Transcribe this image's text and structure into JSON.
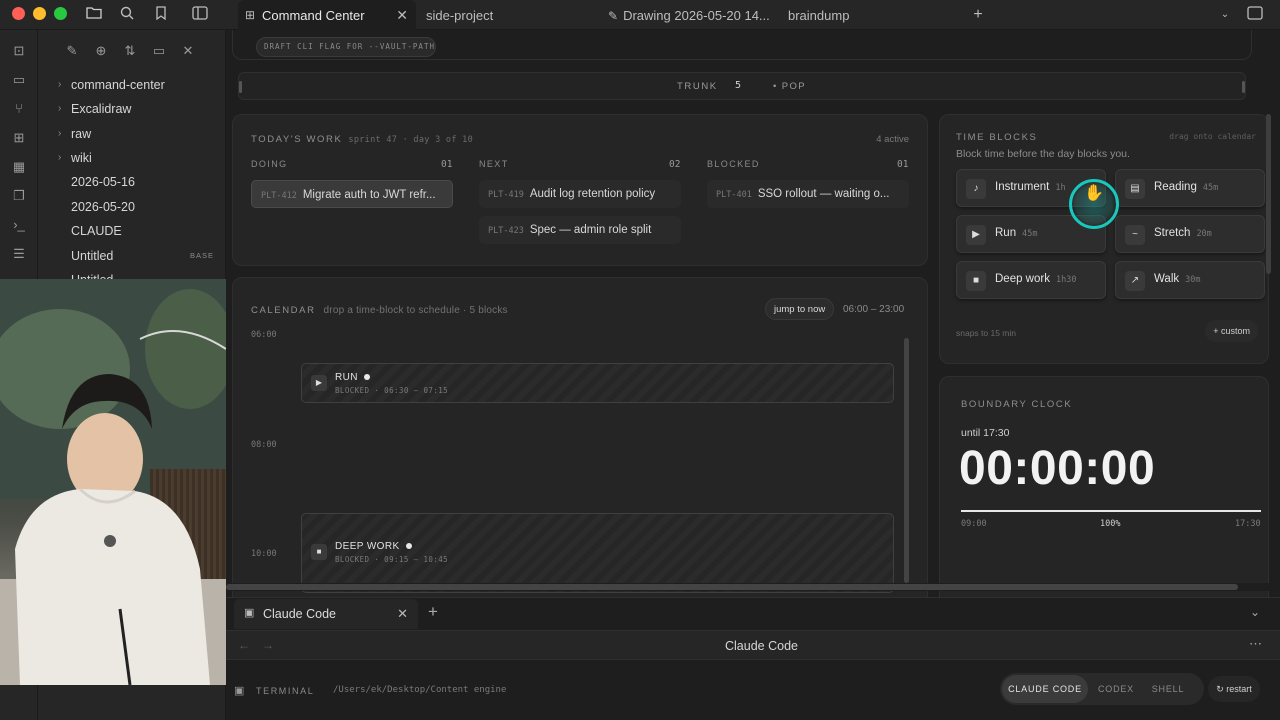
{
  "tabs": [
    {
      "label": "Command Center",
      "icon": "grid-icon",
      "active": true
    },
    {
      "label": "side-project"
    },
    {
      "label": "Drawing 2026-05-20 14...",
      "icon": "excalidraw-icon"
    },
    {
      "label": "braindump"
    }
  ],
  "explorer": {
    "items": [
      {
        "label": "command-center",
        "folder": true
      },
      {
        "label": "Excalidraw",
        "folder": true
      },
      {
        "label": "raw",
        "folder": true
      },
      {
        "label": "wiki",
        "folder": true
      },
      {
        "label": "2026-05-16",
        "folder": false
      },
      {
        "label": "2026-05-20",
        "folder": false
      },
      {
        "label": "CLAUDE",
        "folder": false
      },
      {
        "label": "Untitled",
        "folder": false,
        "badge": "BASE"
      },
      {
        "label": "Untitled",
        "folder": false
      }
    ]
  },
  "top_strip": {
    "hint": "DRAFT CLI FLAG FOR --VAULT-PATH",
    "trunk_label": "TRUNK",
    "trunk_count": "5",
    "pop_label": "• POP"
  },
  "todays_work": {
    "title": "TODAY'S WORK",
    "subtitle": "sprint 47 · day 3 of 10",
    "active_count": "4 active",
    "columns": [
      {
        "name": "DOING",
        "count": "01",
        "tickets": [
          {
            "id": "PLT-412",
            "title": "Migrate auth to JWT refr...",
            "active": true
          }
        ]
      },
      {
        "name": "NEXT",
        "count": "02",
        "tickets": [
          {
            "id": "PLT-419",
            "title": "Audit log retention policy"
          },
          {
            "id": "PLT-423",
            "title": "Spec — admin role split"
          }
        ]
      },
      {
        "name": "BLOCKED",
        "count": "01",
        "tickets": [
          {
            "id": "PLT-401",
            "title": "SSO rollout — waiting o..."
          }
        ]
      }
    ]
  },
  "time_blocks": {
    "title": "TIME BLOCKS",
    "hint": "drag onto calendar",
    "subtitle": "Block time before the day blocks you.",
    "blocks": [
      {
        "name": "Instrument",
        "duration": "1h",
        "icon": "music-note-icon",
        "glyph": "♪"
      },
      {
        "name": "Reading",
        "duration": "45m",
        "icon": "book-icon",
        "glyph": "▤"
      },
      {
        "name": "Run",
        "duration": "45m",
        "icon": "play-icon",
        "glyph": "▶"
      },
      {
        "name": "Stretch",
        "duration": "20m",
        "icon": "tilde-icon",
        "glyph": "~"
      },
      {
        "name": "Deep work",
        "duration": "1h30",
        "icon": "square-icon",
        "glyph": "■"
      },
      {
        "name": "Walk",
        "duration": "30m",
        "icon": "arrow-icon",
        "glyph": "↗"
      }
    ],
    "snap_note": "snaps to 15 min",
    "custom_label": "+ custom"
  },
  "calendar": {
    "title": "CALENDAR",
    "subtitle": "drop a time-block to schedule · 5 blocks",
    "jump_label": "jump to now",
    "range": "06:00 – 23:00",
    "hours": [
      "06:00",
      "08:00",
      "10:00"
    ],
    "events": [
      {
        "name": "RUN",
        "status": "BLOCKED",
        "time": "06:30 – 07:15",
        "glyph": "▶"
      },
      {
        "name": "DEEP WORK",
        "status": "BLOCKED",
        "time": "09:15 – 10:45",
        "glyph": "■"
      }
    ]
  },
  "boundary_clock": {
    "title": "BOUNDARY CLOCK",
    "until": "until 17:30",
    "time": "00:00:00",
    "start": "09:00",
    "percent": "100%",
    "end": "17:30",
    "progress": 1.0
  },
  "bottom_panel": {
    "tab_label": "Claude Code",
    "header_title": "Claude Code",
    "terminal_label": "TERMINAL",
    "path": "/Users/ek/Desktop/Content engine",
    "modes": [
      "CLAUDE CODE",
      "CODEX",
      "SHELL"
    ],
    "active_mode": "CLAUDE CODE",
    "restart_label": "restart"
  }
}
